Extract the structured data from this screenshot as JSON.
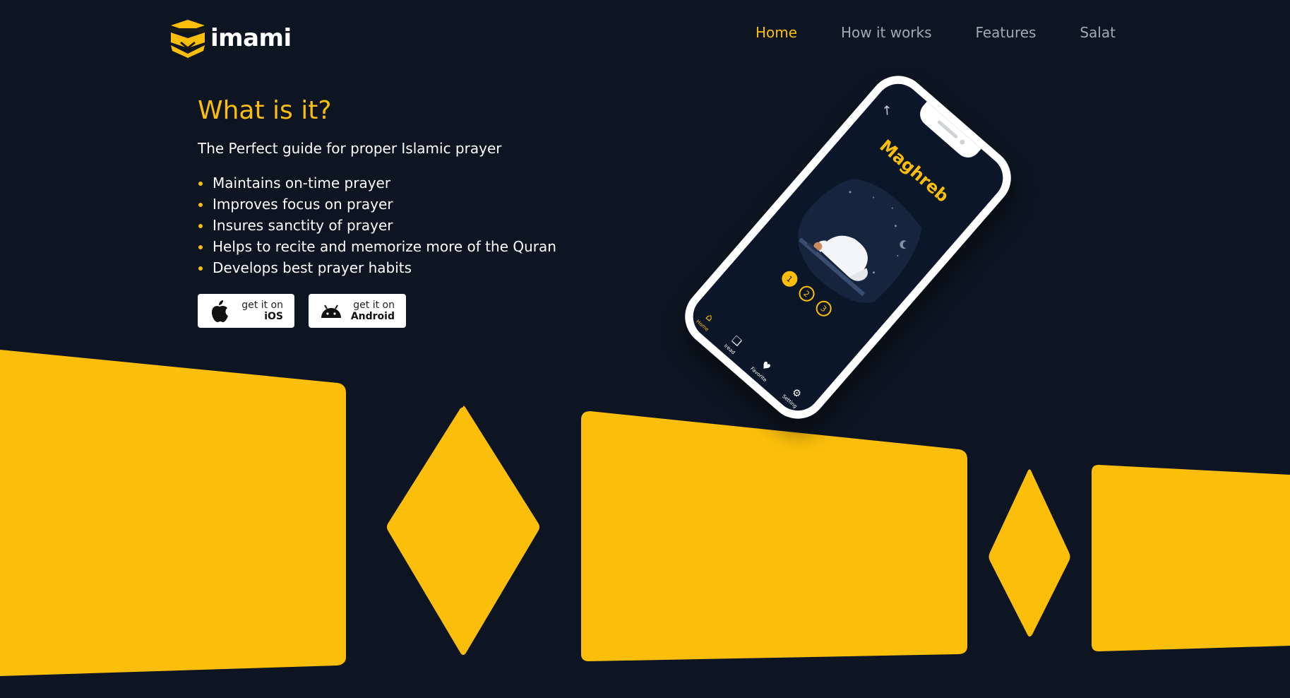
{
  "brand": {
    "name": "imami",
    "logo_icon": "kaaba-logo-icon",
    "accent_color": "#fbbf0b",
    "background_color": "#0c1521"
  },
  "nav": {
    "items": [
      {
        "label": "Home",
        "active": true
      },
      {
        "label": "How it works",
        "active": false
      },
      {
        "label": "Features",
        "active": false
      },
      {
        "label": "Salat",
        "active": false
      }
    ]
  },
  "hero": {
    "title": "What is it?",
    "tagline": "The Perfect guide for proper Islamic prayer",
    "features": [
      "Maintains on-time prayer",
      "Improves focus on prayer",
      "Insures sanctity of prayer",
      "Helps to recite and memorize more of the Quran",
      "Develops best prayer habits"
    ]
  },
  "stores": {
    "ios": {
      "small": "get it on",
      "big": "iOS",
      "icon": "apple-icon"
    },
    "android": {
      "small": "get it on",
      "big": "Android",
      "icon": "android-icon"
    }
  },
  "phone": {
    "back_icon": "back-arrow-icon",
    "prayer_name": "Maghreb",
    "steps": [
      "1",
      "2",
      "3"
    ],
    "active_step": 0,
    "tabs": [
      {
        "label": "Home",
        "icon": "home-icon",
        "active": true
      },
      {
        "label": "Iread",
        "icon": "read-icon",
        "active": false
      },
      {
        "label": "Favorite",
        "icon": "heart-icon",
        "active": false
      },
      {
        "label": "Setting",
        "icon": "gear-icon",
        "active": false
      }
    ]
  }
}
